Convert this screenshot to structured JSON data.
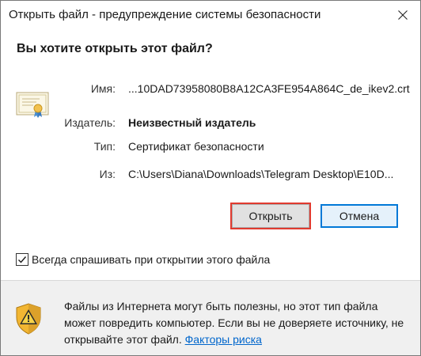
{
  "window": {
    "title": "Открыть файл - предупреждение системы безопасности"
  },
  "question": "Вы хотите открыть этот файл?",
  "details": [
    {
      "label": "Имя:",
      "value": "...10DAD73958080B8A12CA3FE954A864C_de_ikev2.crt",
      "bold": false
    },
    {
      "label": "Издатель:",
      "value": "Неизвестный издатель",
      "bold": true
    },
    {
      "label": "Тип:",
      "value": "Сертификат безопасности",
      "bold": false
    },
    {
      "label": "Из:",
      "value": "C:\\Users\\Diana\\Downloads\\Telegram Desktop\\E10D...",
      "bold": false
    }
  ],
  "buttons": {
    "open_label": "Открыть",
    "cancel_label": "Отмена"
  },
  "checkbox": {
    "label": "Всегда спрашивать при открытии этого файла",
    "checked": true
  },
  "footer": {
    "text": "Файлы из Интернета могут быть полезны, но этот тип файла может повредить компьютер. Если вы не доверяете источнику, не открывайте этот файл.",
    "link_label": "Факторы риска"
  },
  "icons": {
    "close": "close-icon",
    "certificate": "certificate-icon",
    "warning_shield": "warning-shield-icon",
    "checkmark": "checkmark-icon"
  },
  "colors": {
    "accent_blue": "#0078d7",
    "link_blue": "#0066cc",
    "focus_red": "#e13b30",
    "footer_bg": "#f0f0f0"
  }
}
